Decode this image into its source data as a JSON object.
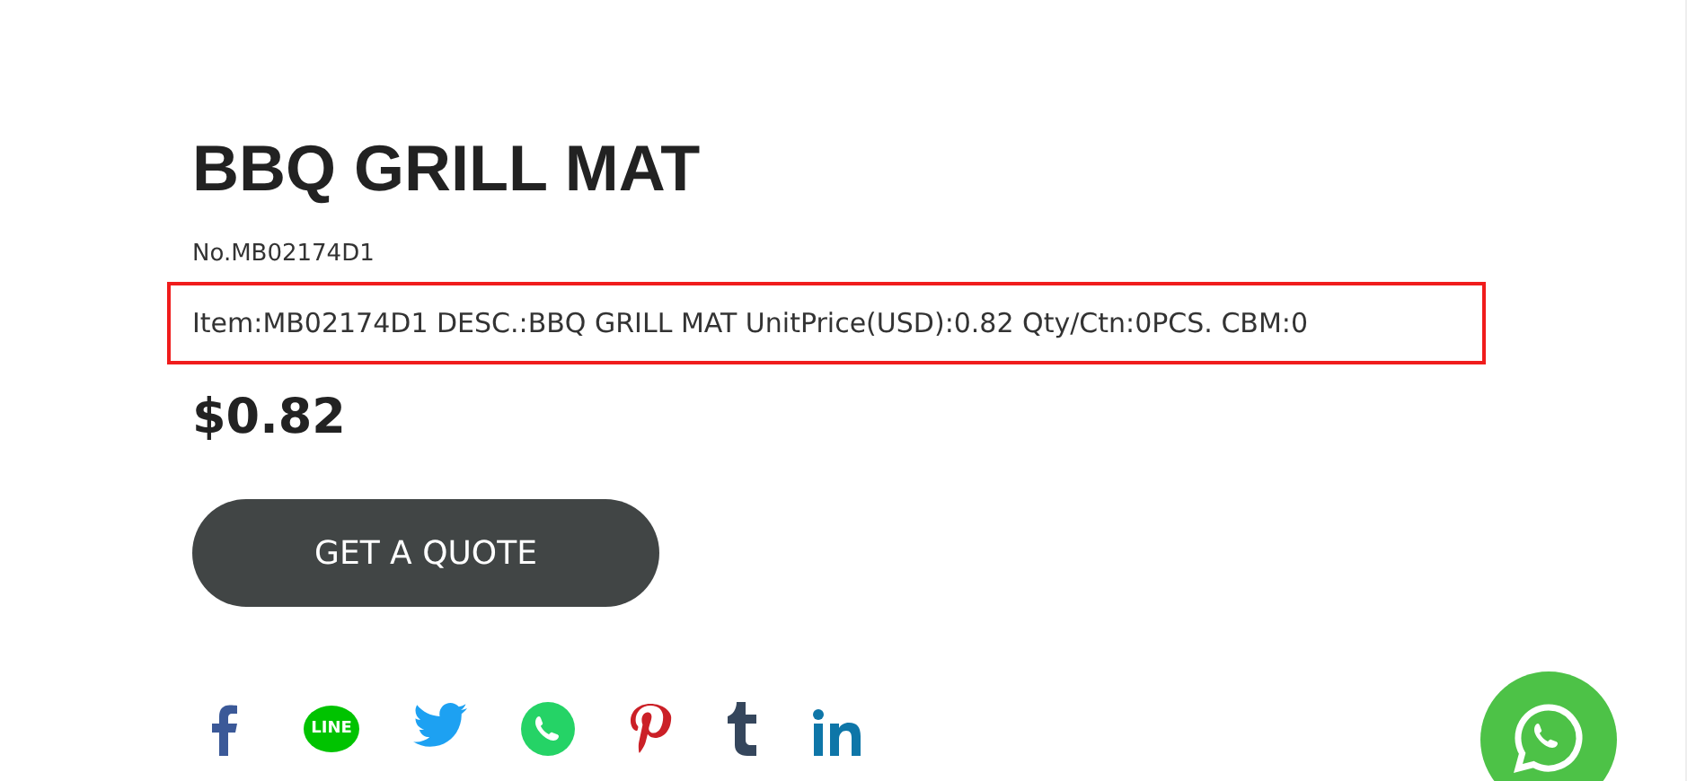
{
  "product": {
    "title": "BBQ GRILL MAT",
    "number": "No.MB02174D1",
    "description": "Item:MB02174D1 DESC.:BBQ GRILL MAT UnitPrice(USD):0.82 Qty/Ctn:0PCS. CBM:0",
    "price": "$0.82"
  },
  "quote_button": {
    "label": "GET A QUOTE"
  },
  "share_buttons": [
    {
      "kind": "facebook"
    },
    {
      "kind": "line",
      "label": "LINE"
    },
    {
      "kind": "twitter"
    },
    {
      "kind": "whatsapp"
    },
    {
      "kind": "pinterest"
    },
    {
      "kind": "tumblr"
    },
    {
      "kind": "linkedin"
    }
  ],
  "floating_chat": {
    "kind": "whatsapp"
  }
}
